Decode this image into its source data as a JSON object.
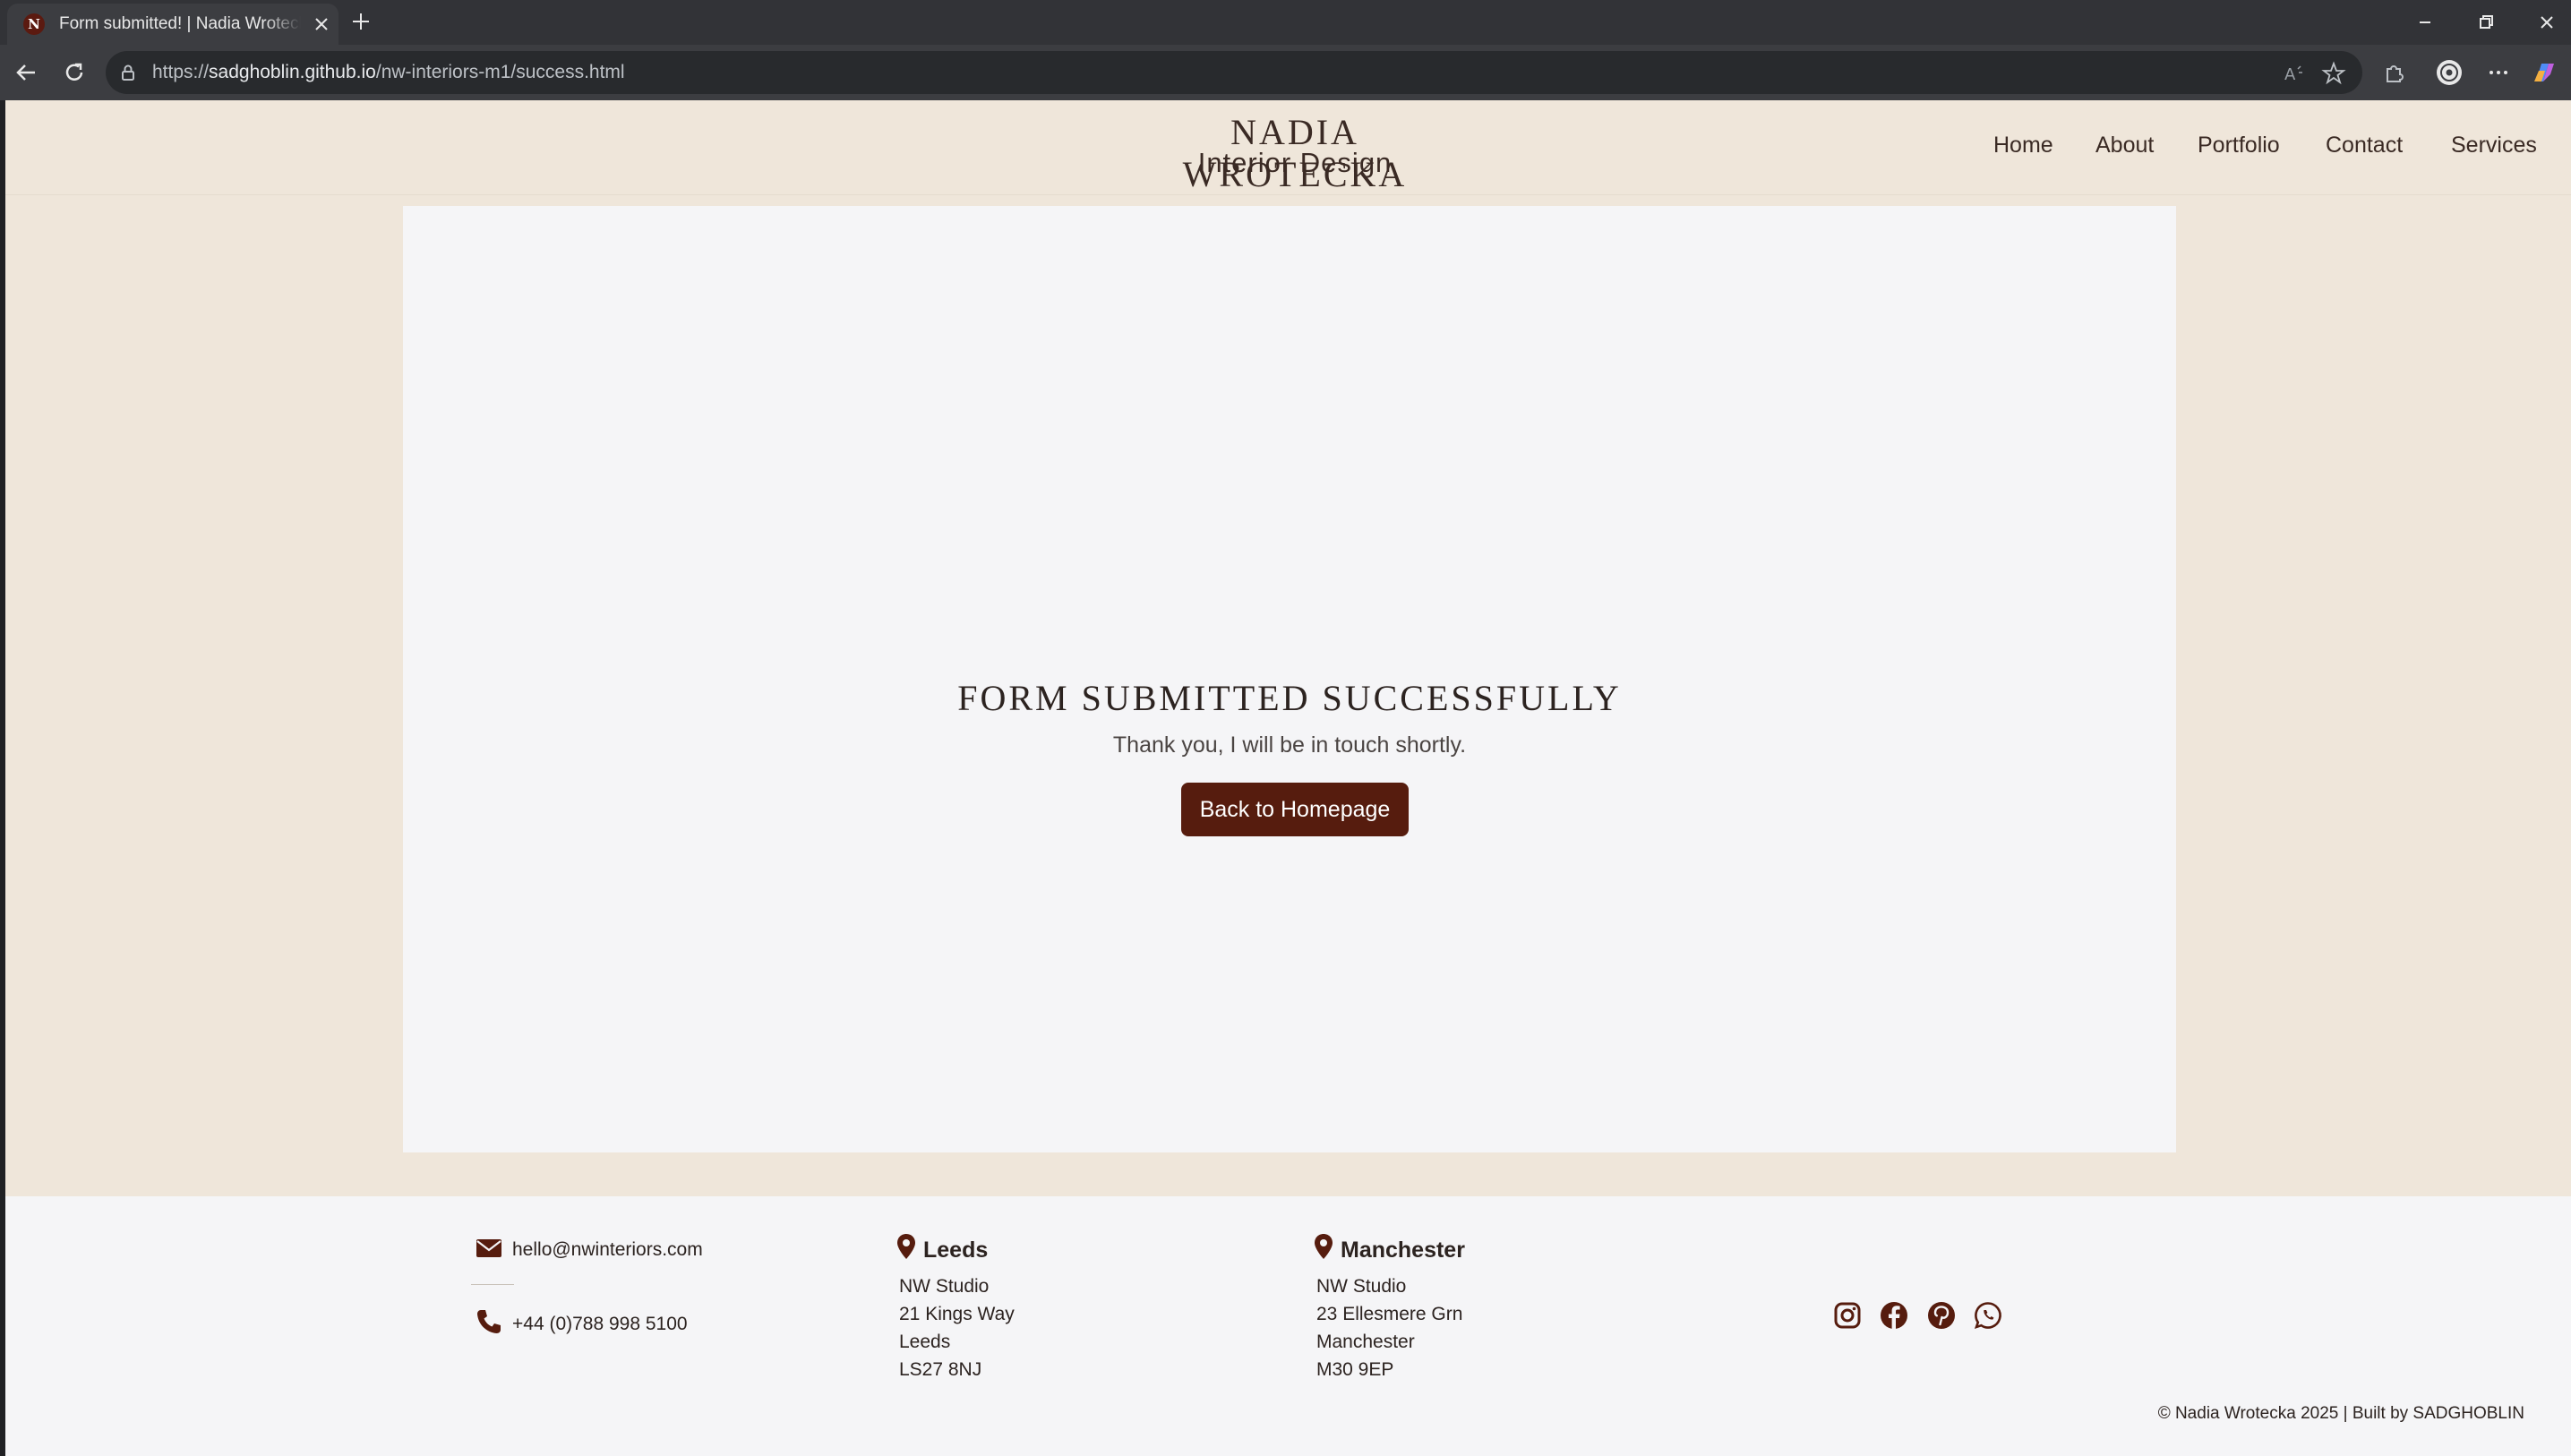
{
  "browser": {
    "tab_title": "Form submitted! | Nadia Wrotecka",
    "tab_favicon_letter": "N",
    "url_prefix": "https://",
    "url_host": "sadghoblin.github.io",
    "url_path": "/nw-interiors-m1/success.html"
  },
  "header": {
    "brand_name": "NADIA WROTECKA",
    "brand_sub": "Interior Design",
    "nav": [
      "Home",
      "About",
      "Portfolio",
      "Contact",
      "Services"
    ]
  },
  "main": {
    "title": "FORM SUBMITTED SUCCESSFULLY",
    "message": "Thank you, I will be in touch shortly.",
    "button_label": "Back to Homepage"
  },
  "footer": {
    "email": "hello@nwinteriors.com",
    "phone": "+44 (0)788 998 5100",
    "locations": [
      {
        "city": "Leeds",
        "lines": [
          "NW Studio",
          "21 Kings Way",
          "Leeds",
          "LS27 8NJ"
        ]
      },
      {
        "city": "Manchester",
        "lines": [
          "NW Studio",
          "23 Ellesmere Grn",
          "Manchester",
          "M30 9EP"
        ]
      }
    ],
    "social": [
      "instagram-icon",
      "facebook-icon",
      "pinterest-icon",
      "whatsapp-icon"
    ],
    "copyright": "© Nadia Wrotecka 2025  |  Built by SADGHOBLIN"
  },
  "colors": {
    "accent": "#561c0e",
    "page_bg": "#efe6da",
    "card_bg": "#f5f5f7",
    "text": "#2c2320"
  }
}
